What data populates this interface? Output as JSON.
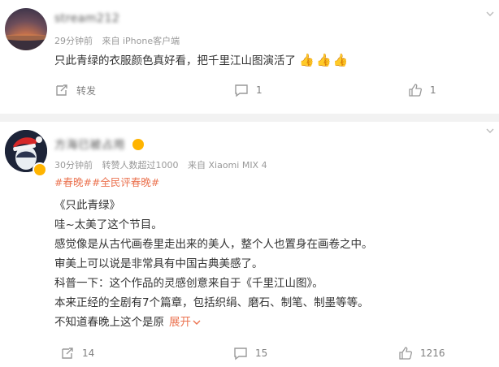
{
  "comments": [
    {
      "username": "stream212",
      "meta": {
        "time": "29分钟前",
        "source": "来自 iPhone客户端"
      },
      "lines": [
        "只此青绿的衣服颜色真好看，把千里江山图演活了"
      ],
      "emoji": "👍👍👍",
      "actions": {
        "repost_label": "转发",
        "comments": "1",
        "likes": "1"
      }
    },
    {
      "username": "方海已被占用",
      "meta": {
        "time": "30分钟前",
        "reposts": "转赞人数超过1000",
        "source": "来自 Xiaomi MIX 4"
      },
      "hashtags": "#春晚##全民评春晚#",
      "lines": [
        "《只此青绿》",
        "哇~太美了这个节目。",
        "感觉像是从古代画卷里走出来的美人，整个人也置身在画卷之中。",
        "审美上可以说是非常具有中国古典美感了。",
        "科普一下：这个作品的灵感创意来自于《千里江山图》。",
        "本来正经的全剧有7个篇章，包括织绢、磨石、制笔、制墨等等。",
        "不知道春晚上这个是原"
      ],
      "expand_label": "展开",
      "actions": {
        "reposts": "14",
        "comments": "15",
        "likes": "1216"
      }
    }
  ],
  "colors": {
    "accent": "#eb7350",
    "meta": "#999999",
    "badge": "#ffb400"
  }
}
